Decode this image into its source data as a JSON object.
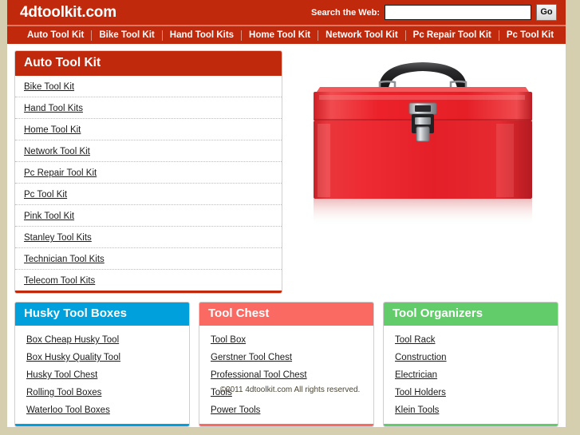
{
  "site": {
    "logo": "4dtoolkit.com",
    "colors": {
      "brand_red": "#c1290d",
      "page_bg": "#d6cfaf",
      "husky_blue": "#00a0dc",
      "tool_chest_salmon": "#fa6a63",
      "tool_organizers_green": "#62cc6b"
    }
  },
  "search": {
    "label": "Search the Web:",
    "value": "",
    "placeholder": "",
    "button_label": "Go"
  },
  "nav": {
    "items": [
      {
        "label": "Auto Tool Kit"
      },
      {
        "label": "Bike Tool Kit"
      },
      {
        "label": "Hand Tool Kits"
      },
      {
        "label": "Home Tool Kit"
      },
      {
        "label": "Network Tool Kit"
      },
      {
        "label": "Pc Repair Tool Kit"
      },
      {
        "label": "Pc Tool Kit"
      }
    ]
  },
  "category_panel": {
    "title": "Auto Tool Kit",
    "items": [
      {
        "label": "Bike Tool Kit"
      },
      {
        "label": "Hand Tool Kits"
      },
      {
        "label": "Home Tool Kit"
      },
      {
        "label": "Network Tool Kit"
      },
      {
        "label": "Pc Repair Tool Kit"
      },
      {
        "label": "Pc Tool Kit"
      },
      {
        "label": "Pink Tool Kit"
      },
      {
        "label": "Stanley Tool Kits"
      },
      {
        "label": "Technician Tool Kits"
      },
      {
        "label": "Telecom Tool Kits"
      }
    ]
  },
  "hero": {
    "image_alt": "red metal toolbox with black handle and chrome latch"
  },
  "panels": [
    {
      "title": "Husky Tool Boxes",
      "color": "#00a0dc",
      "items": [
        {
          "label": "Box Cheap Husky Tool"
        },
        {
          "label": "Box Husky Quality Tool"
        },
        {
          "label": "Husky Tool Chest"
        },
        {
          "label": "Rolling Tool Boxes"
        },
        {
          "label": "Waterloo Tool Boxes"
        }
      ]
    },
    {
      "title": "Tool Chest",
      "color": "#fa6a63",
      "items": [
        {
          "label": "Tool Box"
        },
        {
          "label": "Gerstner Tool Chest"
        },
        {
          "label": "Professional Tool Chest"
        },
        {
          "label": "Tools"
        },
        {
          "label": "Power Tools"
        }
      ]
    },
    {
      "title": "Tool Organizers",
      "color": "#62cc6b",
      "items": [
        {
          "label": "Tool Rack"
        },
        {
          "label": "Construction"
        },
        {
          "label": "Electrician"
        },
        {
          "label": "Tool Holders"
        },
        {
          "label": "Klein Tools"
        }
      ]
    }
  ],
  "footer": {
    "text": "©2011 4dtoolkit.com All rights reserved."
  }
}
